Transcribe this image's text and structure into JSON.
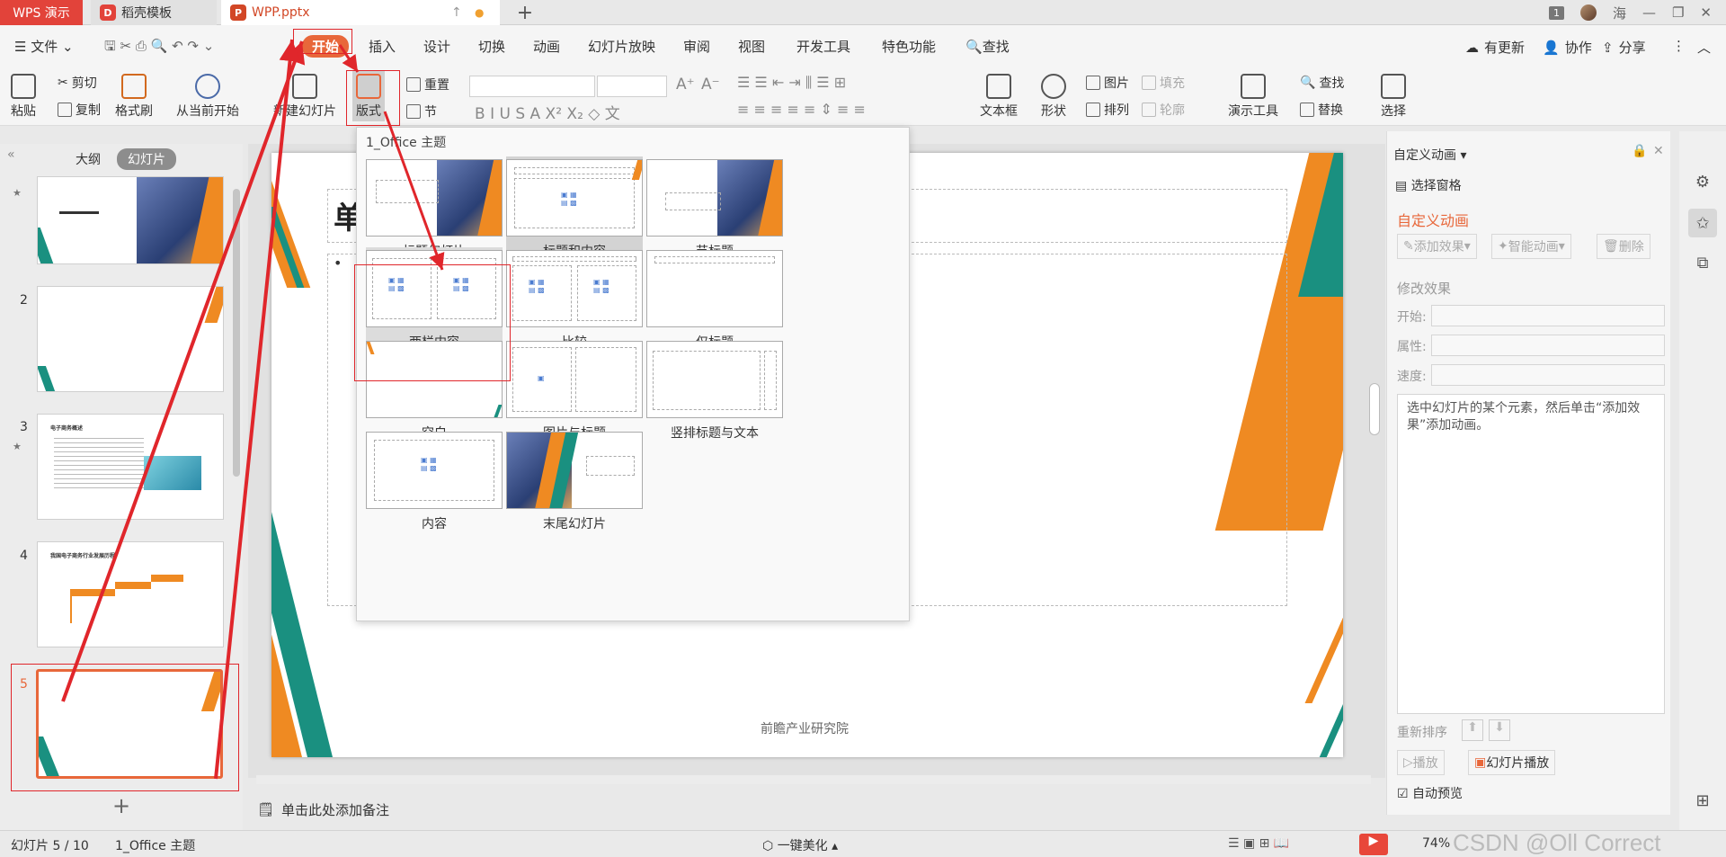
{
  "tabs": {
    "app": "WPS 演示",
    "template": "稻壳模板",
    "file": "WPP.pptx",
    "user": "海",
    "badge": "1"
  },
  "menu": {
    "file": "文件",
    "items": [
      "开始",
      "插入",
      "设计",
      "切换",
      "动画",
      "幻灯片放映",
      "审阅",
      "视图",
      "开发工具",
      "特色功能"
    ],
    "search": "查找",
    "update": "有更新",
    "collab": "协作",
    "share": "分享"
  },
  "ribbon": {
    "paste": "粘贴",
    "cut": "剪切",
    "copy": "复制",
    "format_painter": "格式刷",
    "from_current": "从当前开始",
    "new_slide": "新建幻灯片",
    "layout": "版式",
    "reset": "重置",
    "section": "节",
    "textbox": "文本框",
    "shape": "形状",
    "picture": "图片",
    "fill": "填充",
    "arrange": "排列",
    "outline": "轮廓",
    "present_tools": "演示工具",
    "find": "查找",
    "replace": "替换",
    "select": "选择"
  },
  "left_panel": {
    "tab_outline": "大纲",
    "tab_slides": "幻灯片",
    "numbers": [
      "2",
      "3",
      "4",
      "5"
    ],
    "slide3_title": "电子商务概述",
    "slide4_title": "我国电子商务行业发展历程"
  },
  "layout_dropdown": {
    "theme_title": "1_Office 主题",
    "layouts": [
      "标题幻灯片",
      "标题和内容",
      "节标题",
      "两栏内容",
      "比较",
      "仅标题",
      "空白",
      "图片与标题",
      "竖排标题与文本",
      "内容",
      "末尾幻灯片"
    ]
  },
  "slide": {
    "title_char": "单",
    "bullet": "•",
    "footer": "前瞻产业研究院"
  },
  "notes": {
    "placeholder": "单击此处添加备注"
  },
  "right_panel": {
    "title": "自定义动画",
    "select_pane": "选择窗格",
    "heading": "自定义动画",
    "add_effect": "添加效果",
    "smart_anim": "智能动画",
    "delete": "删除",
    "modify": "修改效果",
    "start": "开始:",
    "property": "属性:",
    "speed": "速度:",
    "hint": "选中幻灯片的某个元素，然后单击“添加效果”添加动画。",
    "reorder": "重新排序",
    "play": "播放",
    "slideshow": "幻灯片播放",
    "autopreview": "自动预览"
  },
  "status": {
    "slide_info": "幻灯片 5 / 10",
    "theme": "1_Office 主题",
    "beautify": "一键美化",
    "zoom": "74%",
    "watermark": "CSDN @Oll Correct"
  },
  "colors": {
    "accent": "#e8673a",
    "teal": "#1a9080",
    "orange": "#ef8a22",
    "annotation": "#e0262b"
  }
}
